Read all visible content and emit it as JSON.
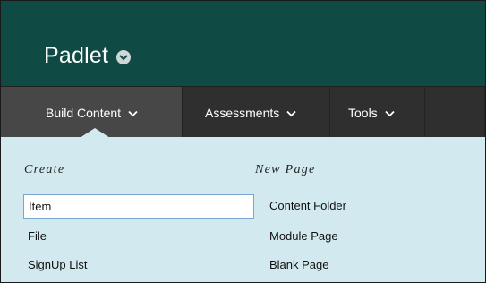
{
  "header": {
    "title": "Padlet",
    "colors": {
      "header_bg": "#0f4a44",
      "nav_bg": "#2f2f2f",
      "nav_active_bg": "#474747",
      "dropdown_bg": "#d2eaef"
    }
  },
  "nav": {
    "tabs": [
      {
        "label": "Build Content",
        "active": true,
        "icon": "chevron-down-icon"
      },
      {
        "label": "Assessments",
        "active": false,
        "icon": "chevron-down-icon"
      },
      {
        "label": "Tools",
        "active": false,
        "icon": "chevron-down-icon"
      }
    ]
  },
  "menu": {
    "create": {
      "heading": "Create",
      "items": [
        "Item",
        "File",
        "SignUp List"
      ]
    },
    "new_page": {
      "heading": "New Page",
      "items": [
        "Content Folder",
        "Module Page",
        "Blank Page"
      ]
    }
  }
}
